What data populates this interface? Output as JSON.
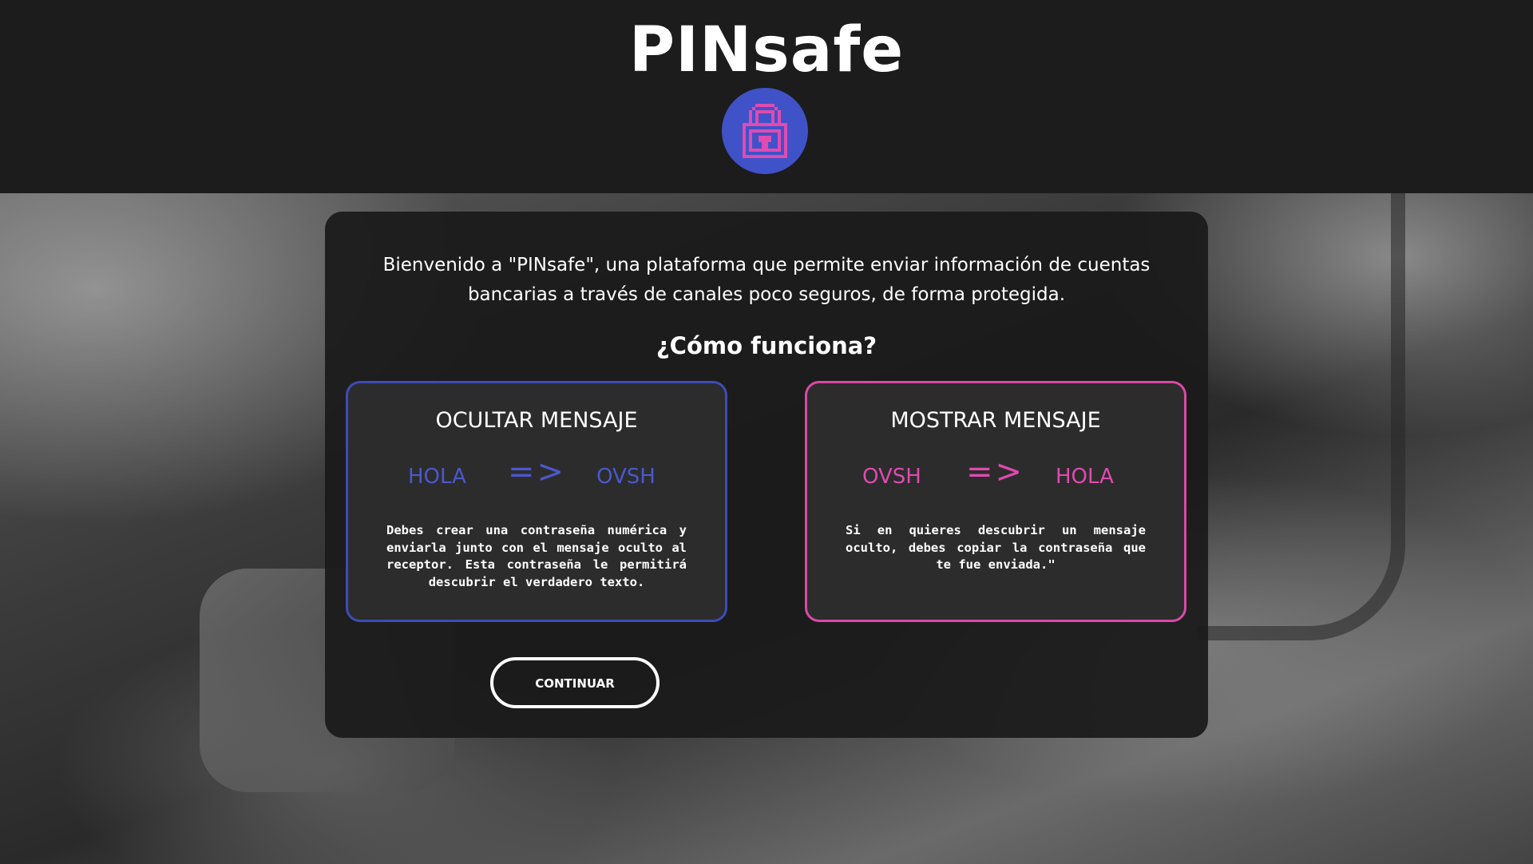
{
  "header": {
    "title": "PINsafe",
    "logo_icon": "padlock-icon",
    "logo_bg_color": "#4052c8",
    "logo_fg_color": "#e04bb0"
  },
  "main": {
    "intro": "Bienvenido a \"PINsafe\", una plataforma que permite enviar información de cuentas bancarias a través de canales poco seguros, de forma protegida.",
    "how_title": "¿Cómo funciona?",
    "cards": [
      {
        "title": "OCULTAR MENSAJE",
        "example_in": "HOLA",
        "arrow": "=>",
        "example_out": "OVSH",
        "description": "Debes crear una contraseña numérica y enviarla junto con el mensaje oculto al receptor. Esta contraseña le permitirá descubrir el verdadero texto.",
        "accent_color": "#3d4cb8"
      },
      {
        "title": "MOSTRAR MENSAJE",
        "example_in": "OVSH",
        "arrow": "=>",
        "example_out": "HOLA",
        "description": "Si en quieres descubrir un mensaje oculto, debes copiar la contraseña que te fue enviada.\"",
        "accent_color": "#d94aa6"
      }
    ],
    "continue_label": "CONTINUAR"
  }
}
